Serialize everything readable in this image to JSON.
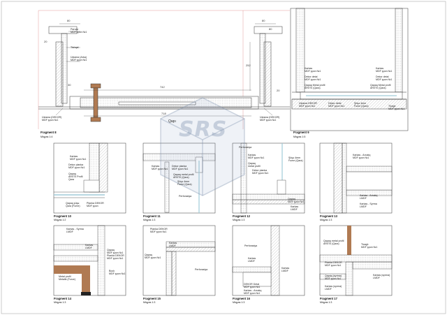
{
  "watermark": "SRS",
  "top": {
    "frag8": {
      "title": "Fragment 8",
      "scale": "Miqyas 1:4"
    },
    "frag9": {
      "title": "Fragment 9",
      "scale": "Miqyas 1:5"
    },
    "dims": {
      "d80a": "80",
      "d20a": "20",
      "d80b": "80",
      "d30": "30",
      "d742": "742",
      "d718": "718",
      "d252": "252",
      "d80c": "80",
      "d20b": "20"
    },
    "door_label": "Qapı",
    "labels": {
      "parvaz": "Parvaz\nMDF şpon №1",
      "tishqal": "Tishqal",
      "uzlama_arka": "Üzlama (Arka)\nMDF şpon №1",
      "uzlama_dekor_l": "Üzlama (DEKOR)\nMDF şpon №1",
      "uzlama_dekor_r": "Üzlama (DEKOR)\nMDF şpon №1",
      "karkas_r": "Karkas\nMDF şpon №1",
      "dekor_detal_r": "Dekor detal\nMDF şpon №1",
      "qapaq_metal_r": "Qapaq Metal profil\nAR0T0 (Qara)",
      "uzlama_dekor_9": "Üzlama DEKOR\nMDF şpon №1",
      "dekor_detal_9": "Dekor detal\nMDF şpon №1",
      "suse_9": "Şüşə 4mm\nFume (Qara)",
      "tixaglı_9": "Tixaglı\nMDF şpon №1",
      "karkas_9": "Karkas\nMDF şpon №1",
      "dekor_detal_9b": "Dekor detal\nMDF şpon №1",
      "qapaq_metal_9": "Qapaq Metal profil\nAR0T0 (Qara)"
    }
  },
  "fragments": [
    {
      "title": "Fragment 10",
      "scale": "Miqyas 1:2",
      "labels": [
        "Karkas\nMDF şpon №1",
        "Dekor planka\nMDF şpon №1",
        "Qapaq\nAR0T0 Profil\nQara",
        "Qapaq şüşə\nQara (Fume)",
        "Planka DEKOR\nMDF şpon"
      ]
    },
    {
      "title": "Fragment 11",
      "scale": "Miqyas 1:3",
      "labels": [
        "Karkas\nMDF şpon №1",
        "Dekor planka\nMDF şpon №1",
        "Qapaq metal profil\nAR0T0 (Qara)",
        "Şüşə 4mm\nFume (Qara)",
        "Perforasiya"
      ]
    },
    {
      "title": "Fragment 12",
      "scale": "Miqyas 1:3",
      "labels": [
        "Perforasiya",
        "Karkas\nMDF şpon №1",
        "Qapaq\nmetal profil",
        "Dekor planka\nMDF şpon №1",
        "Şüşə 4mm\nFume (Qara)",
        "Qapaq\nMDF şpon №1",
        "Karkas\nLMDF"
      ]
    },
    {
      "title": "Fragment 13",
      "scale": "Miqyas 1:3",
      "labels": [
        "Karkas - Arxalıq\nMDF şpon №1",
        "Karkas - Arxalıq\nLMDF",
        "Karkas - Syrma\nLMDF"
      ]
    },
    {
      "title": "Fragment 14",
      "scale": "Miqyas 1:3",
      "labels": [
        "Karkas - Syrma\nLMDF",
        "Karkas\nLMDF",
        "Qapaq\nMDF şpon №1",
        "Planka DEKOR\nMDF şpon №1",
        "Metal profil\nMetalik (Force)",
        "Bock\nMDF şpon №1"
      ]
    },
    {
      "title": "Fragment 15",
      "scale": "Miqyas 1:3",
      "labels": [
        "Planka DEKOR\nMDF şpon №1",
        "Karkas\nLMDF",
        "Qapaq\nMDF şpon №1",
        "Perforasiya"
      ]
    },
    {
      "title": "Fragment 16",
      "scale": "Miqyas 1:3",
      "labels": [
        "Perforasiya",
        "Karkas\nLMDF",
        "Karkas\nLMDF",
        "DEKOR Detal\nMDF şpon №1",
        "Karkas - Arxalıq\nMDF şpon №1"
      ]
    },
    {
      "title": "Fragment 17",
      "scale": "Miqyas 1:3",
      "labels": [
        "Qapaq metal profil\nAR0T0 (Qara)",
        "Tixaglı\nMDF şpon №1",
        "Planka DEKOR\nMDF şpon №1",
        "Qapaq (syrma)\nMDF şpon №1",
        "Karkas (syrma)\nLMDF",
        "Karkas (syrma)\nLMDF"
      ]
    }
  ],
  "colors": {
    "line": "#333333",
    "wood": "#b07a52",
    "glass": "#9fcad8",
    "hatch": "#888888"
  }
}
